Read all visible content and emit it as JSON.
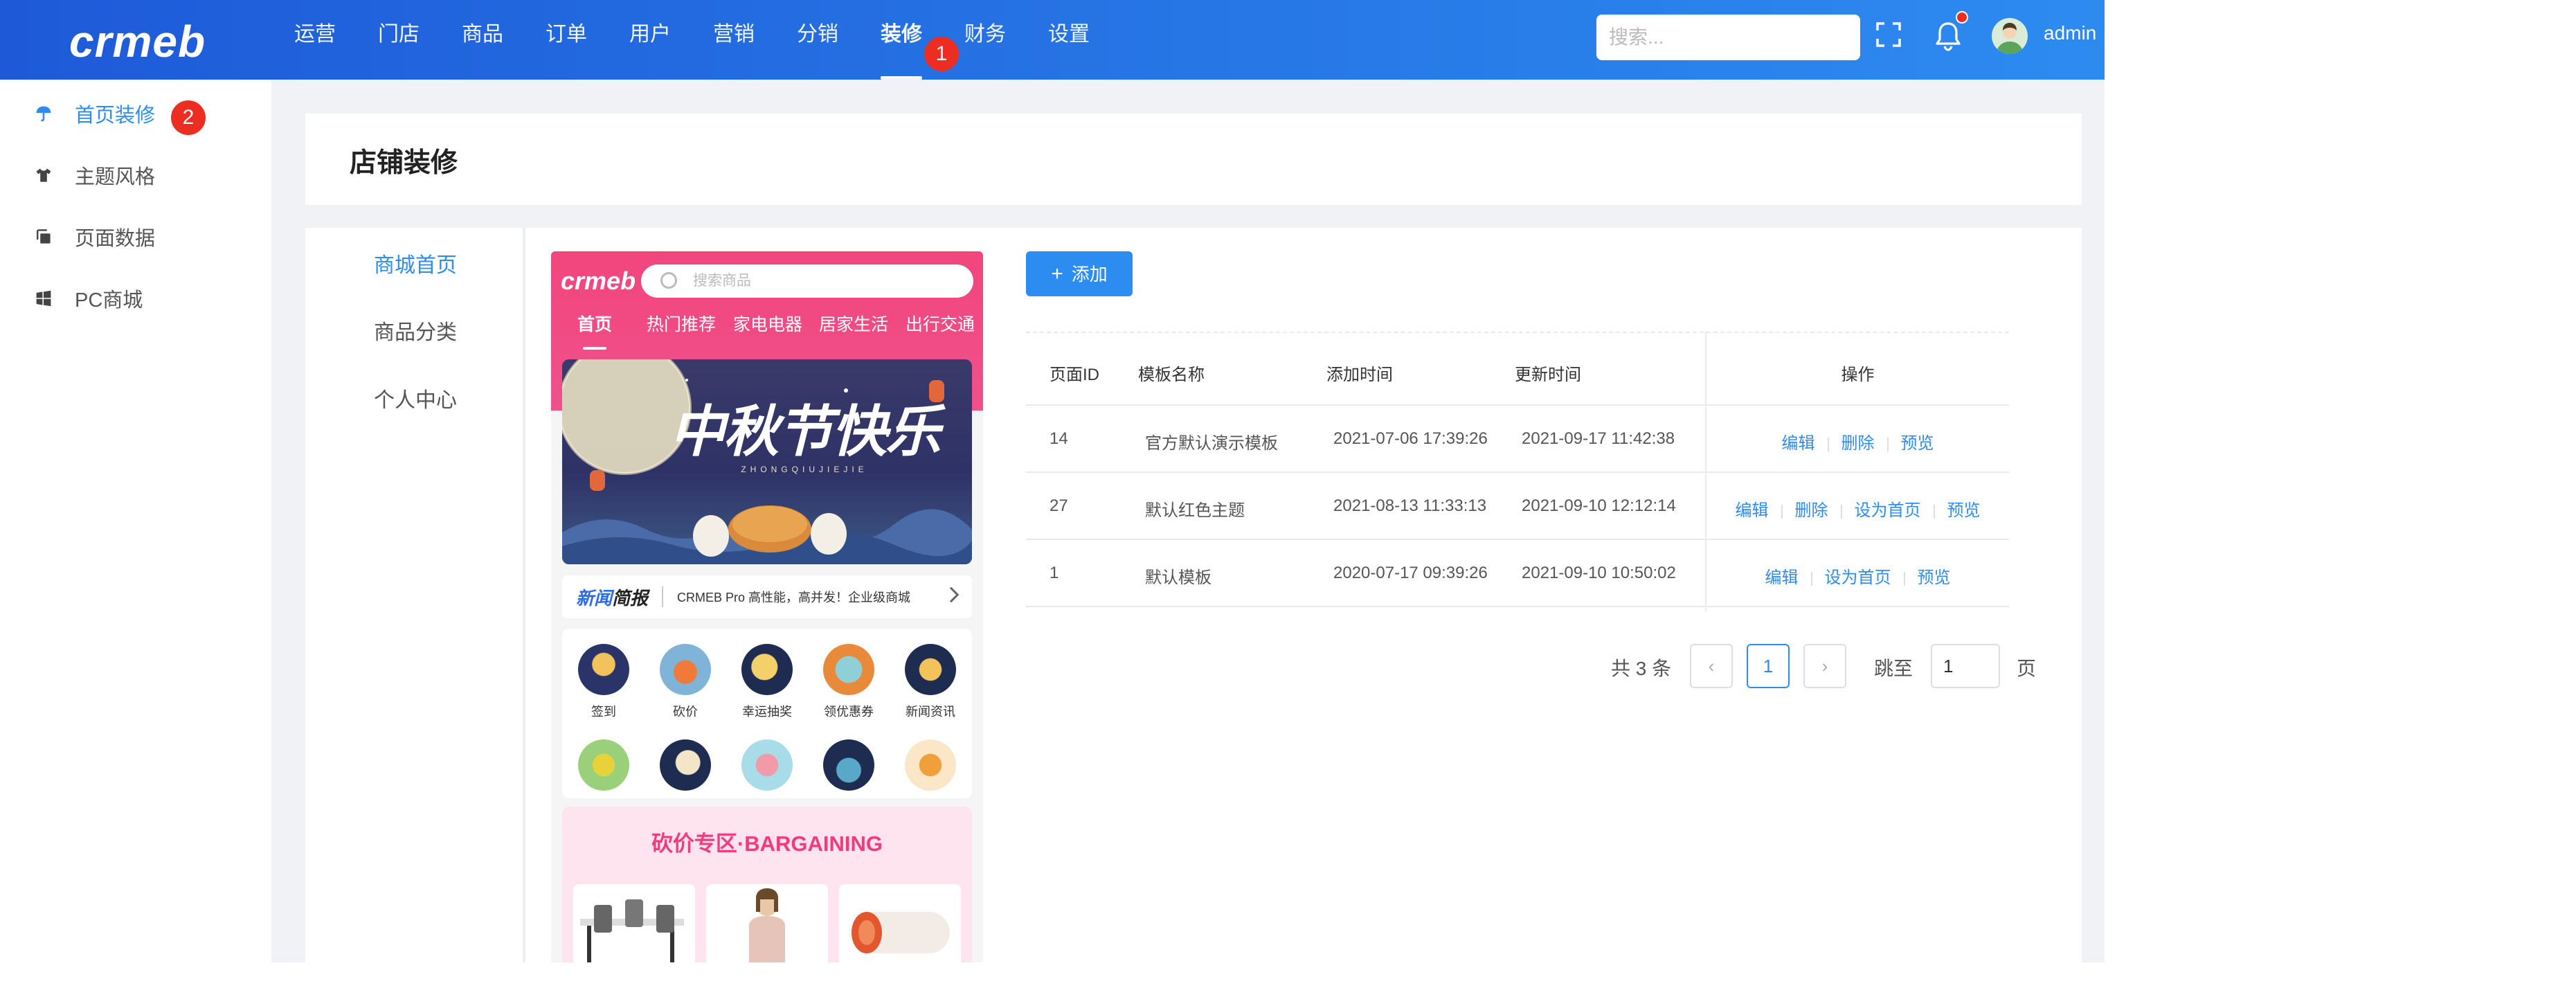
{
  "header": {
    "logo": "crmeb",
    "nav": [
      "运营",
      "门店",
      "商品",
      "订单",
      "用户",
      "营销",
      "分销",
      "装修",
      "财务",
      "设置"
    ],
    "active_nav_index": 7,
    "badge_nav": "1",
    "search_placeholder": "搜索...",
    "user": "admin"
  },
  "sidebar": {
    "items": [
      {
        "label": "首页装修",
        "icon": "umbrella-icon",
        "active": true
      },
      {
        "label": "主题风格",
        "icon": "tshirt-icon",
        "active": false
      },
      {
        "label": "页面数据",
        "icon": "copy-icon",
        "active": false
      },
      {
        "label": "PC商城",
        "icon": "windows-icon",
        "active": false
      }
    ],
    "badge": "2"
  },
  "page": {
    "title": "店铺装修"
  },
  "left_nav": {
    "items": [
      "商城首页",
      "商品分类",
      "个人中心"
    ],
    "active_index": 0
  },
  "preview": {
    "logo": "crmeb",
    "search_placeholder": "搜索商品",
    "tabs": [
      "首页",
      "热门推荐",
      "家电电器",
      "居家生活",
      "出行交通"
    ],
    "banner_text": "中秋节快乐",
    "banner_sub": "ZHONGQIUJIEJIE",
    "news_title_a": "新闻",
    "news_title_b": "简报",
    "news_text": "CRMEB Pro 高性能，高并发！企业级商城",
    "grid": [
      "签到",
      "砍价",
      "幸运抽奖",
      "领优惠券",
      "新闻资讯",
      "",
      "",
      "",
      "",
      ""
    ],
    "bargain_title": "砍价专区·BARGAINING"
  },
  "toolbar": {
    "add_label": "添加",
    "add_icon": "plus-icon"
  },
  "table": {
    "columns": [
      "页面ID",
      "模板名称",
      "添加时间",
      "更新时间",
      "操作"
    ],
    "rows": [
      {
        "id": "14",
        "name": "官方默认演示模板",
        "added": "2021-07-06 17:39:26",
        "updated": "2021-09-17 11:42:38",
        "actions": [
          "编辑",
          "删除",
          "预览"
        ]
      },
      {
        "id": "27",
        "name": "默认红色主题",
        "added": "2021-08-13 11:33:13",
        "updated": "2021-09-10 12:12:14",
        "actions": [
          "编辑",
          "删除",
          "设为首页",
          "预览"
        ]
      },
      {
        "id": "1",
        "name": "默认模板",
        "added": "2020-07-17 09:39:26",
        "updated": "2021-09-10 10:50:02",
        "actions": [
          "编辑",
          "设为首页",
          "预览"
        ]
      }
    ]
  },
  "pager": {
    "total": "共 3 条",
    "current": "1",
    "jump_label": "跳至",
    "jump_value": "1",
    "page_unit": "页"
  },
  "colors": {
    "accent": "#2d8cf0",
    "header_start": "#1e5ad8",
    "header_end": "#2d8bf0",
    "badge": "#ec2d22",
    "preview_pink": "#f2457d"
  }
}
